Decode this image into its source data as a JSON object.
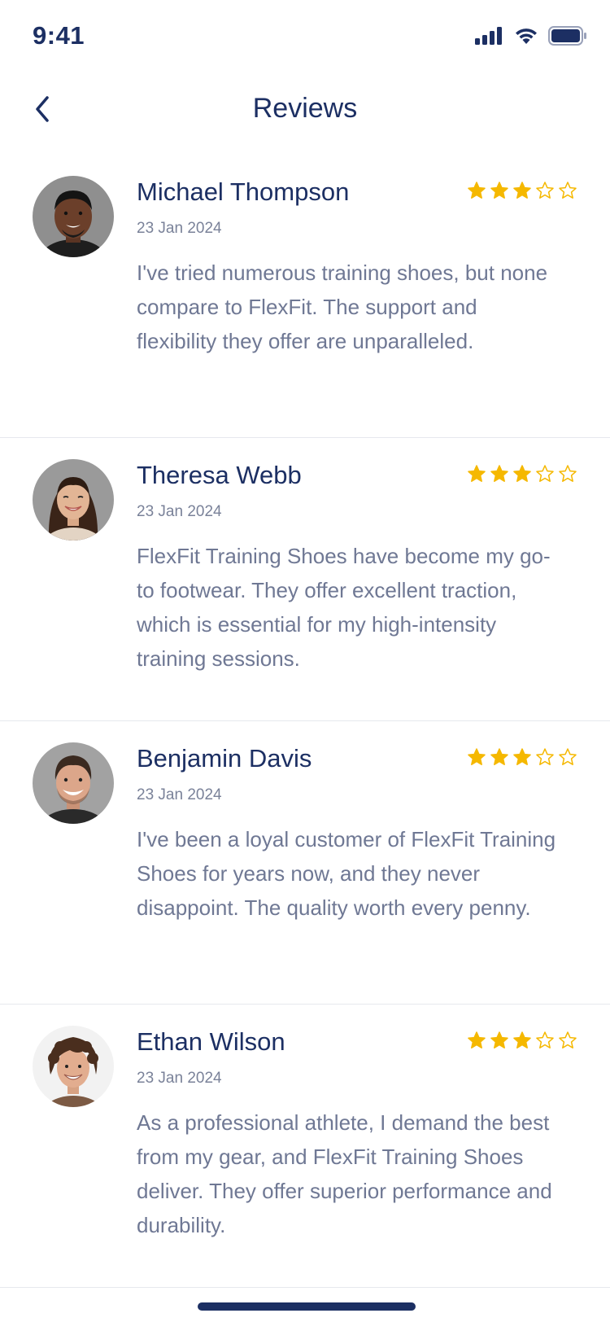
{
  "status_bar": {
    "time": "9:41",
    "icons": [
      "signal-icon",
      "wifi-icon",
      "battery-icon"
    ]
  },
  "header": {
    "title": "Reviews",
    "back_icon": "chevron-left-icon"
  },
  "colors": {
    "primary": "#1c2f63",
    "star": "#f5b800",
    "text_muted": "#6f7894",
    "divider": "#e6e8ee"
  },
  "reviews": [
    {
      "name": "Michael Thompson",
      "date": "23 Jan 2024",
      "rating": 3,
      "max_rating": 5,
      "text": "I've tried numerous training shoes, but none compare to FlexFit. The support and flexibility they offer are unparalleled."
    },
    {
      "name": "Theresa Webb",
      "date": "23 Jan 2024",
      "rating": 3,
      "max_rating": 5,
      "text": "FlexFit Training Shoes have become my go-to footwear. They offer excellent traction, which is essential for my high-intensity training sessions."
    },
    {
      "name": "Benjamin Davis",
      "date": "23 Jan 2024",
      "rating": 3,
      "max_rating": 5,
      "text": "I've been a loyal customer of FlexFit Training Shoes for years now, and they never disappoint. The quality worth every penny."
    },
    {
      "name": "Ethan Wilson",
      "date": "23 Jan 2024",
      "rating": 3,
      "max_rating": 5,
      "text": "As a professional athlete, I demand the best from my gear, and FlexFit Training Shoes deliver. They offer superior performance and durability."
    }
  ]
}
